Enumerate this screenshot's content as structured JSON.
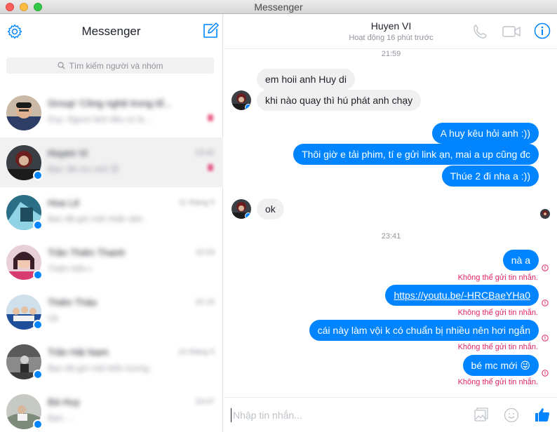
{
  "window": {
    "title": "Messenger"
  },
  "sidebar": {
    "title": "Messenger",
    "search_placeholder": "Tìm kiếm người và nhóm",
    "conversations": [
      {
        "name": "Group' Công nghệ trong tổ...",
        "snippet": "Duy: Ngươi ảnh đầu có là ...",
        "time": "",
        "active": false
      },
      {
        "name": "Huyen Vi",
        "snippet": "Bạn: Bé mc mới 😊",
        "time": "23:41",
        "active": true
      },
      {
        "name": "Hoa Lê",
        "snippet": "Bạn đã gửi một nhãn dán.",
        "time": "11 tháng 5",
        "active": false
      },
      {
        "name": "Trần Thiên Thanh",
        "snippet": "Thiện hiểu r",
        "time": "22:03",
        "active": false
      },
      {
        "name": "Thiên Thảo",
        "snippet": "Ok",
        "time": "22:15",
        "active": false
      },
      {
        "name": "Trần Hải Nam",
        "snippet": "Bạn đã gửi một biểu tượng.",
        "time": "10 tháng 5",
        "active": false
      },
      {
        "name": "Bá Huy",
        "snippet": "Bạn: ...",
        "time": "23:07",
        "active": false
      }
    ]
  },
  "chat": {
    "peer_name": "Huyen VI",
    "peer_status": "Hoạt động 16 phút trước",
    "timestamp_1": "21:59",
    "timestamp_2": "23:41",
    "messages": {
      "m1": "em hoii anh Huy di",
      "m2": "khi nào quay thì hú phát anh chạy",
      "m3": "A huy kêu hỏi anh :))",
      "m4": "Thôi giờ e tải phim, tí e gửi link ạn, mai a up cũng đc",
      "m5": "Thúe 2 đi nha a :))",
      "m6": "ok",
      "m7": "nà a",
      "m8": "https://youtu.be/-HRCBaeYHa0",
      "m9": "cái này làm vội k có chuẩn bị nhiều nên hơi ngắn",
      "m10": "bé mc mới 😜"
    },
    "error_text": "Không thể gửi tin nhắn.",
    "composer_placeholder": "Nhập tin nhắn..."
  },
  "colors": {
    "accent": "#0084ff",
    "error": "#e0245e",
    "incoming_bubble": "#f1f0f0"
  },
  "icons": [
    "gear-icon",
    "compose-icon",
    "search-icon",
    "phone-icon",
    "video-icon",
    "info-icon",
    "image-icon",
    "emoji-icon",
    "like-icon",
    "error-icon",
    "messenger-badge-icon"
  ]
}
